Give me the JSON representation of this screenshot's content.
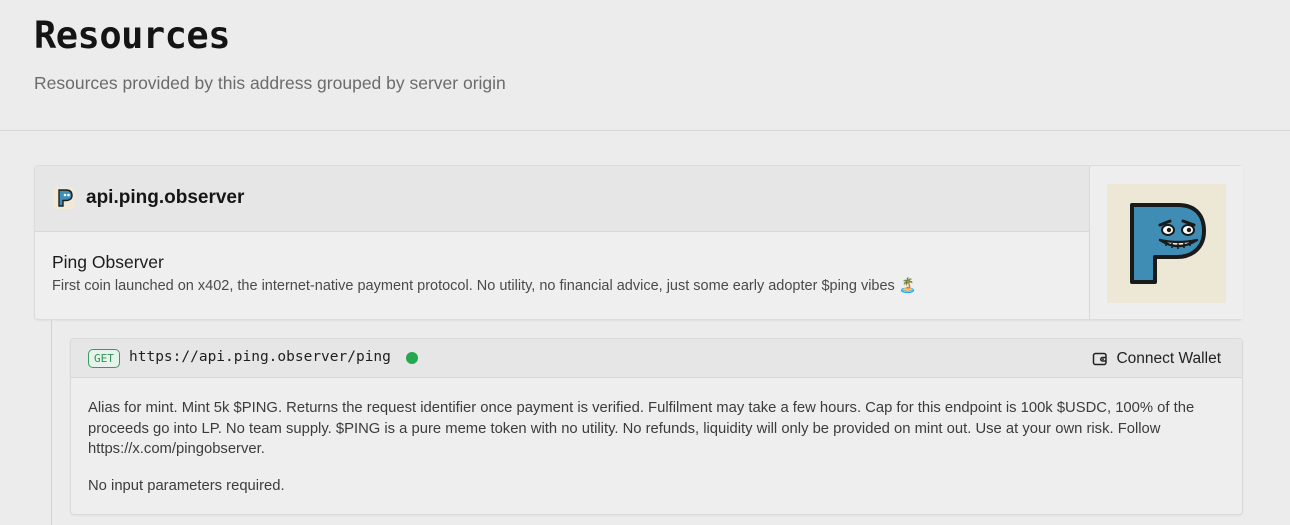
{
  "page": {
    "title": "Resources",
    "subtitle": "Resources provided by this address grouped by server origin"
  },
  "origin": {
    "domain": "api.ping.observer",
    "name": "Ping Observer",
    "description": "First coin launched on x402, the internet-native payment protocol. No utility, no financial advice, just some early adopter $ping vibes 🏝️",
    "favicon_icon": "ping-p-logo-icon",
    "logo_icon": "ping-observer-logo-icon",
    "accent_color": "#3d8fb8"
  },
  "endpoint": {
    "method": "GET",
    "url": "https://api.ping.observer/ping",
    "status": "online",
    "status_color": "#25a84f",
    "connect_label": "Connect Wallet",
    "connect_icon": "wallet-icon",
    "description": "Alias for mint. Mint 5k $PING. Returns the request identifier once payment is verified. Fulfilment may take a few hours. Cap for this endpoint is 100k $USDC, 100% of the proceeds go into LP. No team supply. $PING is a pure meme token with no utility. No refunds, liquidity will only be provided on mint out. Use at your own risk. Follow https://x.com/pingobserver.",
    "params_text": "No input parameters required."
  }
}
